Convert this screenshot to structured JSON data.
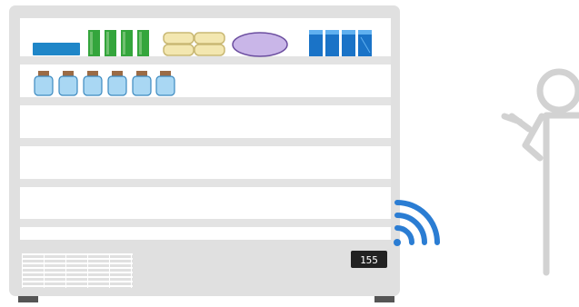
{
  "display": {
    "text": "155"
  },
  "colors": {
    "cabinet": "#e0e0e0",
    "cabinet_inner": "#ffffff",
    "shelf": "#e3e3e3",
    "vent_line": "#ffffff",
    "feet": "#555555",
    "blue_box": "#1f86c8",
    "green_pack": "#34a53c",
    "green_pack_light": "#6fc06f",
    "tan_box": "#f3e7b0",
    "tan_box_stroke": "#c9b874",
    "lavender_oval": "#c9b6e8",
    "lavender_stroke": "#6b4d9f",
    "blue_carton": "#1a73c7",
    "blue_carton_light": "#5fb0f0",
    "jar_body": "#a9d7f3",
    "jar_stroke": "#3c8ac0",
    "jar_lid": "#9b6b45",
    "display_bg": "#222222",
    "display_text": "#ffffff",
    "wifi": "#2b7dd3",
    "person_stroke": "#d2d2d2"
  },
  "icons": {
    "wifi": "wifi-signal-icon",
    "person": "person-with-tablet-icon"
  }
}
